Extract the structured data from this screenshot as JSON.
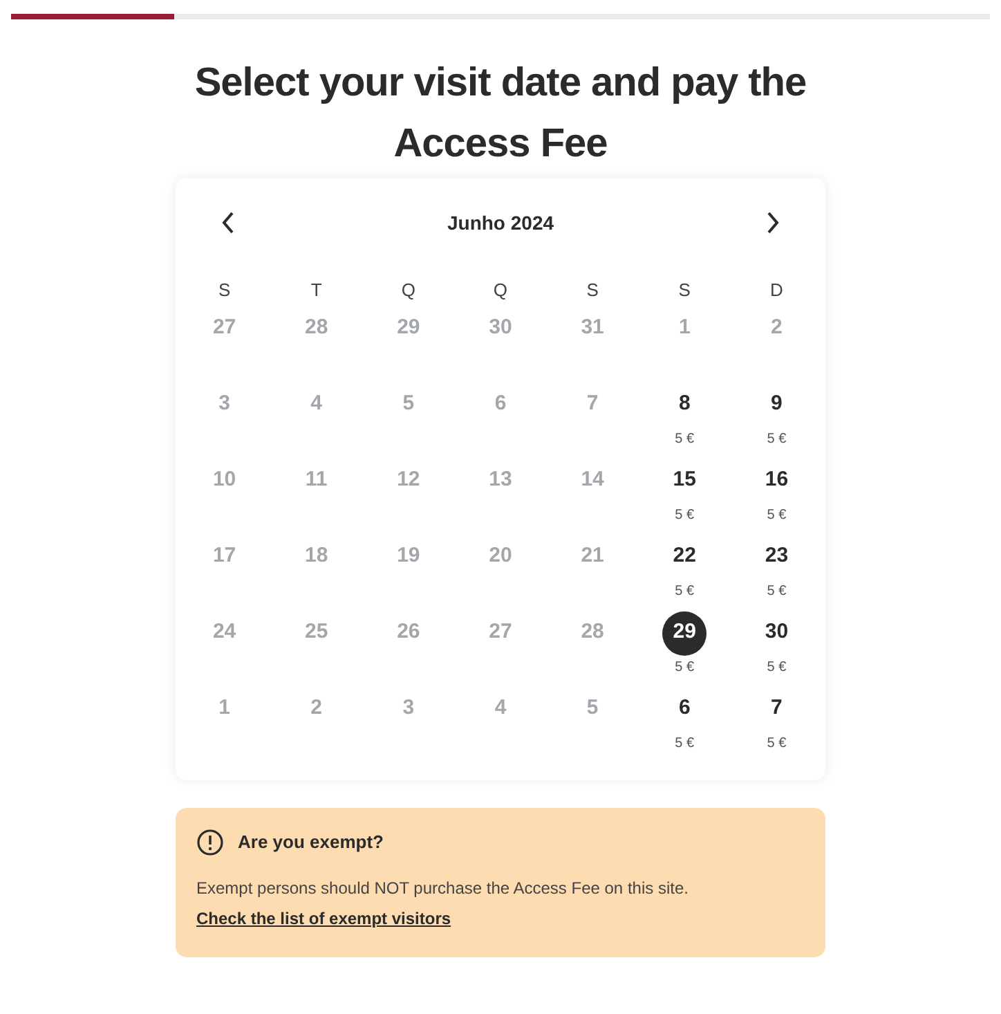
{
  "progress": {
    "level": 0.166
  },
  "title": "Select your visit date and pay the Access Fee",
  "calendar": {
    "month": "Junho 2024",
    "weekdays": [
      "S",
      "T",
      "Q",
      "Q",
      "S",
      "S",
      "D"
    ],
    "weeks": [
      [
        {
          "day": "27",
          "available": false,
          "selected": false
        },
        {
          "day": "28",
          "available": false,
          "selected": false
        },
        {
          "day": "29",
          "available": false,
          "selected": false
        },
        {
          "day": "30",
          "available": false,
          "selected": false
        },
        {
          "day": "31",
          "available": false,
          "selected": false
        },
        {
          "day": "1",
          "available": false,
          "selected": false
        },
        {
          "day": "2",
          "available": false,
          "selected": false
        }
      ],
      [
        {
          "day": "3",
          "available": false,
          "selected": false
        },
        {
          "day": "4",
          "available": false,
          "selected": false
        },
        {
          "day": "5",
          "available": false,
          "selected": false
        },
        {
          "day": "6",
          "available": false,
          "selected": false
        },
        {
          "day": "7",
          "available": false,
          "selected": false
        },
        {
          "day": "8",
          "available": true,
          "selected": false,
          "price": "5 €"
        },
        {
          "day": "9",
          "available": true,
          "selected": false,
          "price": "5 €"
        }
      ],
      [
        {
          "day": "10",
          "available": false,
          "selected": false
        },
        {
          "day": "11",
          "available": false,
          "selected": false
        },
        {
          "day": "12",
          "available": false,
          "selected": false
        },
        {
          "day": "13",
          "available": false,
          "selected": false
        },
        {
          "day": "14",
          "available": false,
          "selected": false
        },
        {
          "day": "15",
          "available": true,
          "selected": false,
          "price": "5 €"
        },
        {
          "day": "16",
          "available": true,
          "selected": false,
          "price": "5 €"
        }
      ],
      [
        {
          "day": "17",
          "available": false,
          "selected": false
        },
        {
          "day": "18",
          "available": false,
          "selected": false
        },
        {
          "day": "19",
          "available": false,
          "selected": false
        },
        {
          "day": "20",
          "available": false,
          "selected": false
        },
        {
          "day": "21",
          "available": false,
          "selected": false
        },
        {
          "day": "22",
          "available": true,
          "selected": false,
          "price": "5 €"
        },
        {
          "day": "23",
          "available": true,
          "selected": false,
          "price": "5 €"
        }
      ],
      [
        {
          "day": "24",
          "available": false,
          "selected": false
        },
        {
          "day": "25",
          "available": false,
          "selected": false
        },
        {
          "day": "26",
          "available": false,
          "selected": false
        },
        {
          "day": "27",
          "available": false,
          "selected": false
        },
        {
          "day": "28",
          "available": false,
          "selected": false
        },
        {
          "day": "29",
          "available": true,
          "selected": true,
          "price": "5 €"
        },
        {
          "day": "30",
          "available": true,
          "selected": false,
          "price": "5 €"
        }
      ],
      [
        {
          "day": "1",
          "available": false,
          "selected": false
        },
        {
          "day": "2",
          "available": false,
          "selected": false
        },
        {
          "day": "3",
          "available": false,
          "selected": false
        },
        {
          "day": "4",
          "available": false,
          "selected": false
        },
        {
          "day": "5",
          "available": false,
          "selected": false
        },
        {
          "day": "6",
          "available": true,
          "selected": false,
          "price": "5 €"
        },
        {
          "day": "7",
          "available": true,
          "selected": false,
          "price": "5 €"
        }
      ]
    ]
  },
  "notice": {
    "title": "Are you exempt?",
    "text": "Exempt persons should NOT purchase the Access Fee on this site.",
    "link": "Check the list of exempt visitors"
  }
}
